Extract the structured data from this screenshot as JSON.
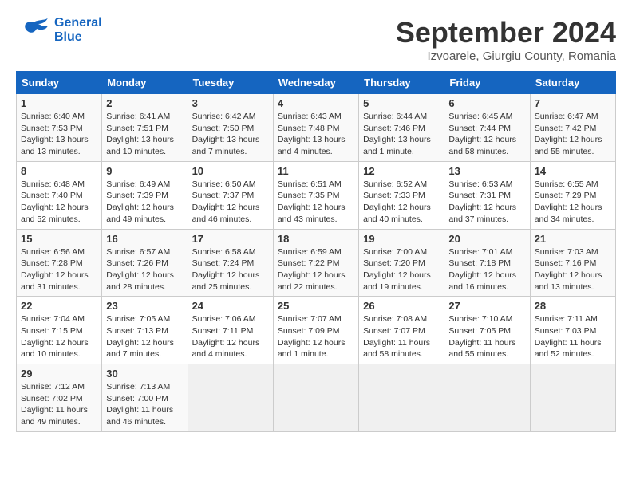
{
  "header": {
    "logo_line1": "General",
    "logo_line2": "Blue",
    "month_title": "September 2024",
    "subtitle": "Izvoarele, Giurgiu County, Romania"
  },
  "weekdays": [
    "Sunday",
    "Monday",
    "Tuesday",
    "Wednesday",
    "Thursday",
    "Friday",
    "Saturday"
  ],
  "weeks": [
    [
      {
        "day": "1",
        "info": "Sunrise: 6:40 AM\nSunset: 7:53 PM\nDaylight: 13 hours\nand 13 minutes."
      },
      {
        "day": "2",
        "info": "Sunrise: 6:41 AM\nSunset: 7:51 PM\nDaylight: 13 hours\nand 10 minutes."
      },
      {
        "day": "3",
        "info": "Sunrise: 6:42 AM\nSunset: 7:50 PM\nDaylight: 13 hours\nand 7 minutes."
      },
      {
        "day": "4",
        "info": "Sunrise: 6:43 AM\nSunset: 7:48 PM\nDaylight: 13 hours\nand 4 minutes."
      },
      {
        "day": "5",
        "info": "Sunrise: 6:44 AM\nSunset: 7:46 PM\nDaylight: 13 hours\nand 1 minute."
      },
      {
        "day": "6",
        "info": "Sunrise: 6:45 AM\nSunset: 7:44 PM\nDaylight: 12 hours\nand 58 minutes."
      },
      {
        "day": "7",
        "info": "Sunrise: 6:47 AM\nSunset: 7:42 PM\nDaylight: 12 hours\nand 55 minutes."
      }
    ],
    [
      {
        "day": "8",
        "info": "Sunrise: 6:48 AM\nSunset: 7:40 PM\nDaylight: 12 hours\nand 52 minutes."
      },
      {
        "day": "9",
        "info": "Sunrise: 6:49 AM\nSunset: 7:39 PM\nDaylight: 12 hours\nand 49 minutes."
      },
      {
        "day": "10",
        "info": "Sunrise: 6:50 AM\nSunset: 7:37 PM\nDaylight: 12 hours\nand 46 minutes."
      },
      {
        "day": "11",
        "info": "Sunrise: 6:51 AM\nSunset: 7:35 PM\nDaylight: 12 hours\nand 43 minutes."
      },
      {
        "day": "12",
        "info": "Sunrise: 6:52 AM\nSunset: 7:33 PM\nDaylight: 12 hours\nand 40 minutes."
      },
      {
        "day": "13",
        "info": "Sunrise: 6:53 AM\nSunset: 7:31 PM\nDaylight: 12 hours\nand 37 minutes."
      },
      {
        "day": "14",
        "info": "Sunrise: 6:55 AM\nSunset: 7:29 PM\nDaylight: 12 hours\nand 34 minutes."
      }
    ],
    [
      {
        "day": "15",
        "info": "Sunrise: 6:56 AM\nSunset: 7:28 PM\nDaylight: 12 hours\nand 31 minutes."
      },
      {
        "day": "16",
        "info": "Sunrise: 6:57 AM\nSunset: 7:26 PM\nDaylight: 12 hours\nand 28 minutes."
      },
      {
        "day": "17",
        "info": "Sunrise: 6:58 AM\nSunset: 7:24 PM\nDaylight: 12 hours\nand 25 minutes."
      },
      {
        "day": "18",
        "info": "Sunrise: 6:59 AM\nSunset: 7:22 PM\nDaylight: 12 hours\nand 22 minutes."
      },
      {
        "day": "19",
        "info": "Sunrise: 7:00 AM\nSunset: 7:20 PM\nDaylight: 12 hours\nand 19 minutes."
      },
      {
        "day": "20",
        "info": "Sunrise: 7:01 AM\nSunset: 7:18 PM\nDaylight: 12 hours\nand 16 minutes."
      },
      {
        "day": "21",
        "info": "Sunrise: 7:03 AM\nSunset: 7:16 PM\nDaylight: 12 hours\nand 13 minutes."
      }
    ],
    [
      {
        "day": "22",
        "info": "Sunrise: 7:04 AM\nSunset: 7:15 PM\nDaylight: 12 hours\nand 10 minutes."
      },
      {
        "day": "23",
        "info": "Sunrise: 7:05 AM\nSunset: 7:13 PM\nDaylight: 12 hours\nand 7 minutes."
      },
      {
        "day": "24",
        "info": "Sunrise: 7:06 AM\nSunset: 7:11 PM\nDaylight: 12 hours\nand 4 minutes."
      },
      {
        "day": "25",
        "info": "Sunrise: 7:07 AM\nSunset: 7:09 PM\nDaylight: 12 hours\nand 1 minute."
      },
      {
        "day": "26",
        "info": "Sunrise: 7:08 AM\nSunset: 7:07 PM\nDaylight: 11 hours\nand 58 minutes."
      },
      {
        "day": "27",
        "info": "Sunrise: 7:10 AM\nSunset: 7:05 PM\nDaylight: 11 hours\nand 55 minutes."
      },
      {
        "day": "28",
        "info": "Sunrise: 7:11 AM\nSunset: 7:03 PM\nDaylight: 11 hours\nand 52 minutes."
      }
    ],
    [
      {
        "day": "29",
        "info": "Sunrise: 7:12 AM\nSunset: 7:02 PM\nDaylight: 11 hours\nand 49 minutes."
      },
      {
        "day": "30",
        "info": "Sunrise: 7:13 AM\nSunset: 7:00 PM\nDaylight: 11 hours\nand 46 minutes."
      },
      {
        "day": "",
        "info": ""
      },
      {
        "day": "",
        "info": ""
      },
      {
        "day": "",
        "info": ""
      },
      {
        "day": "",
        "info": ""
      },
      {
        "day": "",
        "info": ""
      }
    ]
  ]
}
